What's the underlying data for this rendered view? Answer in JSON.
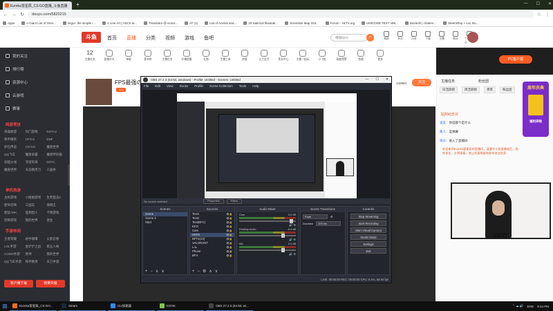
{
  "browser": {
    "tab_title": "Eureka冒星辰_CS:GO直播_斗鱼直播",
    "url": "douyu.com/5820215",
    "window_controls": [
      "—",
      "☐",
      "✕"
    ],
    "bookmarks": [
      "Apps",
      "A Giant List of Over...",
      "imgur: the simple i...",
      "1 Line Art | ASCII ar...",
      "Translator @ ecoto...",
      "AT (1)",
      "List of Animal and...",
      "20 Satirical Illustrati...",
      "Scientists Map Out...",
      "Forum - HLTV.org",
      "UNICODE TEST v86...",
      "Davie2k | chaters...",
      "SteemRep » LoL Bo..."
    ]
  },
  "site": {
    "logo_text": "斗鱼",
    "nav": [
      "首页",
      "直播",
      "分类",
      "视频",
      "游戏",
      "鱼吧"
    ],
    "nav_active_index": 1,
    "search_placeholder": "嗅嗅DEO",
    "header_icons": [
      "搜索",
      "关注",
      "历史",
      "下载",
      "主播",
      "粉丝",
      "个人中心"
    ]
  },
  "sidebar": {
    "items": [
      "我的关注",
      "排行榜",
      "资源中心",
      "云游戏",
      "赛事"
    ],
    "cat1": "网游竞技",
    "grid1": [
      "英雄联盟",
      "热门游戏",
      "DOTA2",
      "和平精英",
      "CF/CS",
      "DNF",
      "炉石传说",
      "CS:GO",
      "魔兽世界",
      "QQ飞车",
      "魔兽争霸",
      "魔兽怀旧服",
      "穿越火线",
      "守望先锋",
      "DOTA",
      "魔兽世界",
      "天涯明月刀",
      "三国杀"
    ],
    "cat2": "单机热游",
    "grid2": [
      "主机游戏",
      "小姐姐游戏",
      "生死狙击2",
      "使命召唤",
      "三国志",
      "海贼王",
      "使徒ARK",
      "怪物猎人",
      "卡牌游戏",
      "恐怖游戏",
      "我的世界",
      "逃生"
    ],
    "cat3": "手游休闲",
    "grid3": [
      "王者荣耀",
      "射手嗅嗅",
      "火影忍者",
      "LOL手游",
      "金铲铲之战",
      "第五人格",
      "CODM手游",
      "原神",
      "我的世界",
      "QQ飞车手游",
      "和平精英",
      "天刀手游"
    ],
    "btn1": "客户端下载",
    "btn2": "我要开播"
  },
  "categories": {
    "count": "12",
    "count_label": "主播任务",
    "items": [
      "直播开关",
      "弹幕",
      "素材库",
      "主播任务",
      "开播提醒",
      "礼物",
      "主播工具",
      "房管",
      "火力全开",
      "鱼丸中心",
      "主播一起玩",
      "小飞船",
      "高能预警",
      "鱼塘",
      "更多"
    ]
  },
  "pc_button": "PC客户端",
  "streamer": {
    "title": "FPS最强の女",
    "level": "LV.1",
    "hot": "142894",
    "follow": "关注"
  },
  "obs": {
    "title": "OBS 27.2.3 (64-bit, windows) - Profile: Untitled - Scenes: Untitled",
    "menu": [
      "File",
      "Edit",
      "View",
      "Docks",
      "Profile",
      "Scene Collection",
      "Tools",
      "Help"
    ],
    "no_source": "No source selected",
    "properties": "Properties",
    "filters": "Filters",
    "docks": {
      "scenes": {
        "title": "Scenes",
        "items": [
          "Scene",
          "Scene 2",
          "Start"
        ]
      },
      "sources": {
        "title": "Sources",
        "items": [
          "Text1",
          "Text2",
          "Text(BFC)",
          "EKO",
          "Cam",
          "HDMI",
          "BFT2(10)",
          "VALORANT",
          "LoL",
          "Phone",
          "BFV"
        ]
      },
      "mixer": {
        "title": "Audio Mixer",
        "rows": [
          "Cam",
          "Desktop Audio",
          "Mic"
        ],
        "db": [
          "0.0 dB",
          "-6.4 dB",
          "0.0 dB"
        ]
      },
      "transitions": {
        "title": "Scene Transitions",
        "type": "Fade",
        "duration_label": "Duration",
        "duration": "300 ms"
      },
      "controls": {
        "title": "Controls",
        "buttons": [
          "Stop Streaming",
          "Start Recording",
          "Start Virtual Camera",
          "Studio Mode",
          "Settings",
          "Exit"
        ]
      }
    },
    "status": "LIVE: 00:00:00   REC: 00:00:00   CPU: 0.4%, 59.94 fps"
  },
  "chat": {
    "tabs": [
      "主播任务",
      "粉丝团"
    ],
    "rank_tabs": [
      "日活跃榜",
      "周活跃榜",
      "贵宾",
      "粉丝团"
    ],
    "banner_title": "周年庆典",
    "banner_sub": "福利来啦",
    "notice": "贴附纪念日",
    "messages": [
      {
        "name": "道友",
        "text": "你说那个是什么"
      },
      {
        "name": "路人",
        "text": "蓝弹幕"
      },
      {
        "name": "观众",
        "text": "进入了直播间"
      }
    ],
    "welcome": "欢迎来到Eureka冒星辰的直播间，请遵守斗鱼直播规范，理性发言，文明观看，禁止恶意刷屏和发布违法信息",
    "cam_logo": "EKO"
  },
  "taskbar": {
    "items": [
      {
        "label": "Eureka冒星辰_CS:GO...",
        "color": "#f26b1d"
      },
      {
        "label": "Steam",
        "color": "#1b2838"
      },
      {
        "label": "UU加速器",
        "color": "#2d8cf0"
      },
      {
        "label": "KOOK",
        "color": "#7ac943"
      },
      {
        "label": "OBS 27.2.3 (64-bit, wi...",
        "color": "#444"
      }
    ],
    "lang": "ENG",
    "time": "9:44 PM"
  }
}
